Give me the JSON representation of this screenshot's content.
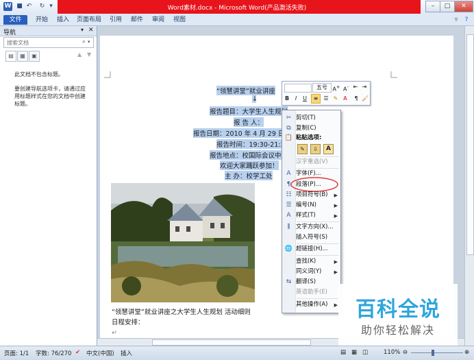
{
  "window": {
    "title": "Word素材.docx - Microsoft Word(产品激活失败)",
    "app_icon_letter": "W"
  },
  "ribbon": {
    "tabs": [
      "文件",
      "开始",
      "插入",
      "页面布局",
      "引用",
      "邮件",
      "审阅",
      "视图"
    ]
  },
  "nav_pane": {
    "title": "导航",
    "search_placeholder": "搜索文档",
    "no_headings": "此文档不包含标题。",
    "hint_lines": [
      "要创建导航选项卡，请通过应",
      "用标题样式在您的文档中创建",
      "标题。"
    ]
  },
  "document": {
    "lines": [
      "“领慧讲堂”就业讲座",
      "报告题目：大学生人生规划",
      "报  告  人：",
      "报告日期：2010 年 4 月 29 日",
      "报告时间：19:30-21:3",
      "报告地点：校国际会议中",
      "欢迎大家踊跃参加！",
      "主  办：校学工处"
    ],
    "caption_line": "“领慧讲堂”就业讲座之大学生人生规划  活动细则",
    "schedule_line": "日程安排："
  },
  "mini_toolbar": {
    "font_size": "五号",
    "buttons": [
      "A+",
      "A-",
      "格式刷"
    ],
    "row2": [
      "B",
      "I",
      "U"
    ]
  },
  "context_menu": {
    "items": [
      {
        "label": "剪切(T)",
        "icon": "scissors-icon",
        "enabled": true
      },
      {
        "label": "复制(C)",
        "icon": "copy-icon",
        "enabled": true
      },
      {
        "label": "粘贴选项:",
        "icon": "paste-icon",
        "enabled": true,
        "bold": true
      },
      {
        "label": "汉字重选(V)",
        "icon": "",
        "enabled": false
      },
      {
        "label": "字体(F)...",
        "icon": "font-icon",
        "enabled": true
      },
      {
        "label": "段落(P)...",
        "icon": "paragraph-icon",
        "enabled": true,
        "highlighted": true
      },
      {
        "label": "项目符号(B)",
        "icon": "bullets-icon",
        "enabled": true,
        "submenu": true
      },
      {
        "label": "编号(N)",
        "icon": "numbering-icon",
        "enabled": true,
        "submenu": true
      },
      {
        "label": "样式(T)",
        "icon": "styles-icon",
        "enabled": true,
        "submenu": true
      },
      {
        "label": "文字方向(X)...",
        "icon": "text-direction-icon",
        "enabled": true
      },
      {
        "label": "插入符号(S)",
        "icon": "",
        "enabled": true
      },
      {
        "label": "超链接(H)...",
        "icon": "hyperlink-icon",
        "enabled": true
      },
      {
        "label": "查找(K)",
        "icon": "",
        "enabled": true,
        "submenu": true
      },
      {
        "label": "同义词(Y)",
        "icon": "",
        "enabled": true,
        "submenu": true
      },
      {
        "label": "翻译(S)",
        "icon": "translate-icon",
        "enabled": true
      },
      {
        "label": "英语助手(E)",
        "icon": "",
        "enabled": false
      },
      {
        "label": "其他操作(A)",
        "icon": "",
        "enabled": true,
        "submenu": true
      }
    ]
  },
  "status_bar": {
    "page": "页面: 1/1",
    "words": "字数: 76/270",
    "language": "中文(中国)",
    "mode": "插入",
    "zoom": "110%"
  },
  "watermark": {
    "title": "百科全说",
    "subtitle": "助你轻松解决"
  },
  "colors": {
    "title_bar": "#e8141b",
    "file_tab": "#2a5fbf",
    "selection": "#b7d0ef",
    "highlight_circle": "#e0393b",
    "watermark_title": "#2fa6dc"
  }
}
